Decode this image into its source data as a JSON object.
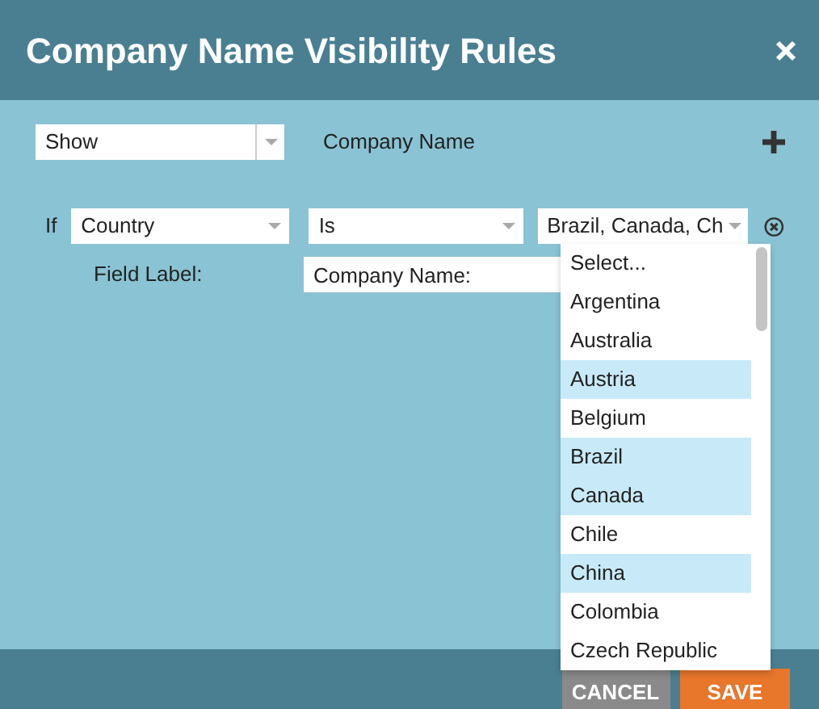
{
  "dialog": {
    "title": "Company Name Visibility Rules"
  },
  "action": {
    "value": "Show"
  },
  "target_label": "Company Name",
  "condition": {
    "prefix": "If",
    "field": "Country",
    "operator": "Is",
    "value": "Brazil, Canada, Ch"
  },
  "field_label": {
    "label": "Field Label:",
    "value": "Company Name:"
  },
  "dropdown": {
    "items": [
      {
        "label": "Select...",
        "selected": false
      },
      {
        "label": "Argentina",
        "selected": false
      },
      {
        "label": "Australia",
        "selected": false
      },
      {
        "label": "Austria",
        "selected": true
      },
      {
        "label": "Belgium",
        "selected": false
      },
      {
        "label": "Brazil",
        "selected": true
      },
      {
        "label": "Canada",
        "selected": true
      },
      {
        "label": "Chile",
        "selected": false
      },
      {
        "label": "China",
        "selected": true
      },
      {
        "label": "Colombia",
        "selected": false
      },
      {
        "label": "Czech Republic",
        "selected": false
      }
    ]
  },
  "buttons": [
    {
      "label": "CANCEL",
      "kind": "secondary"
    },
    {
      "label": "SAVE",
      "kind": "primary"
    }
  ]
}
